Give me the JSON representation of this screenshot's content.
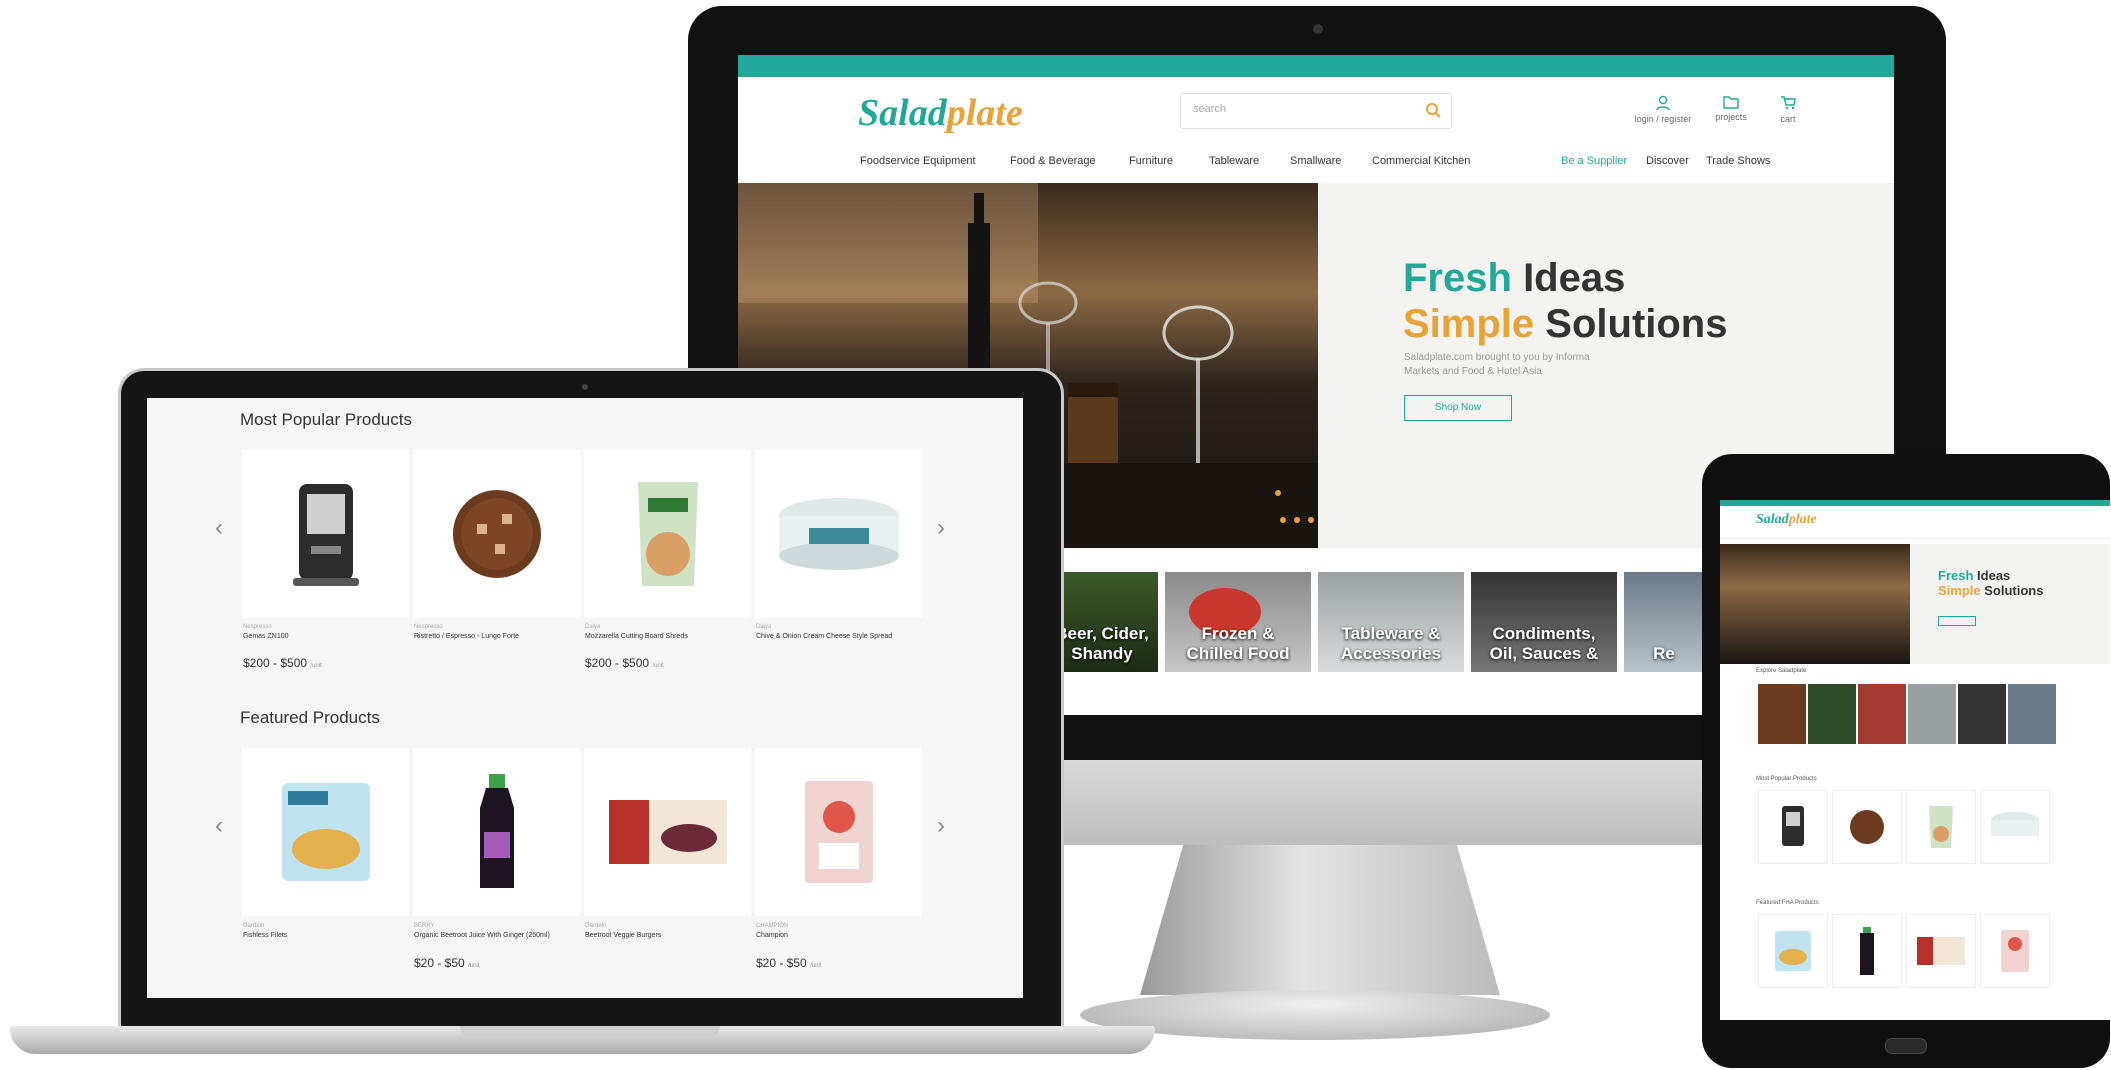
{
  "brand": {
    "name_part1": "Salad",
    "name_part2": "plate",
    "accent": "#21a898",
    "secondary": "#e8a23a"
  },
  "header": {
    "search_placeholder": "search",
    "icons": [
      {
        "icon": "user-icon",
        "label": "login / register"
      },
      {
        "icon": "folder-icon",
        "label": "projects"
      },
      {
        "icon": "cart-icon",
        "label": "cart"
      }
    ]
  },
  "nav": {
    "left": [
      "Foodservice Equipment",
      "Food & Beverage",
      "Furniture",
      "Tableware",
      "Smallware",
      "Commercial Kitchen"
    ],
    "right": [
      "Be a Supplier",
      "Discover",
      "Trade Shows"
    ]
  },
  "hero": {
    "line1_accent": "Fresh",
    "line1_rest": "Ideas",
    "line2_accent": "Simple",
    "line2_rest": "Solutions",
    "subtitle": "Saladplate.com brought to you by Informa Markets and Food & Hotel Asia",
    "button": "Shop Now"
  },
  "explore": {
    "title_fragment": "e",
    "categories": [
      "Beer, Cider, Shandy",
      "Frozen & Chilled Food",
      "Tableware & Accessories",
      "Condiments, Oil, Sauces &",
      "Re"
    ]
  },
  "most_popular": {
    "title": "Most Popular Products",
    "products": [
      {
        "brand": "Nespresso",
        "name": "Gemas ZN100",
        "price": "$200 - $500",
        "unit": "/unit"
      },
      {
        "brand": "Nespresso",
        "name": "Ristretto / Espresso - Lungo Forte",
        "price": "",
        "unit": ""
      },
      {
        "brand": "Daiya",
        "name": "Mozzarella Cutting Board Shreds",
        "price": "$200 - $500",
        "unit": "/unit"
      },
      {
        "brand": "Daiya",
        "name": "Chive & Onion Cream Cheese Style Spread",
        "price": "",
        "unit": ""
      }
    ]
  },
  "featured": {
    "title": "Featured Products",
    "products": [
      {
        "brand": "Gardein",
        "name": "Fishless Filets",
        "price": "",
        "unit": ""
      },
      {
        "brand": "BERRY",
        "name": "Organic Beetroot Juice With Ginger (250ml)",
        "price": "$20 - $50",
        "unit": "/unit"
      },
      {
        "brand": "Gardein",
        "name": "Beetroot Veggie Burgers",
        "price": "",
        "unit": ""
      },
      {
        "brand": "CHAMPION",
        "name": "Champion",
        "price": "$20 - $50",
        "unit": "/unit"
      }
    ]
  },
  "tablet": {
    "hero_line1_accent": "Fresh",
    "hero_line1_rest": "Ideas",
    "hero_line2_accent": "Simple",
    "hero_line2_rest": "Solutions",
    "explore_title": "Explore Saladplate",
    "popular_title": "Most Popular Products",
    "featured_title": "Featured FHA Products"
  }
}
